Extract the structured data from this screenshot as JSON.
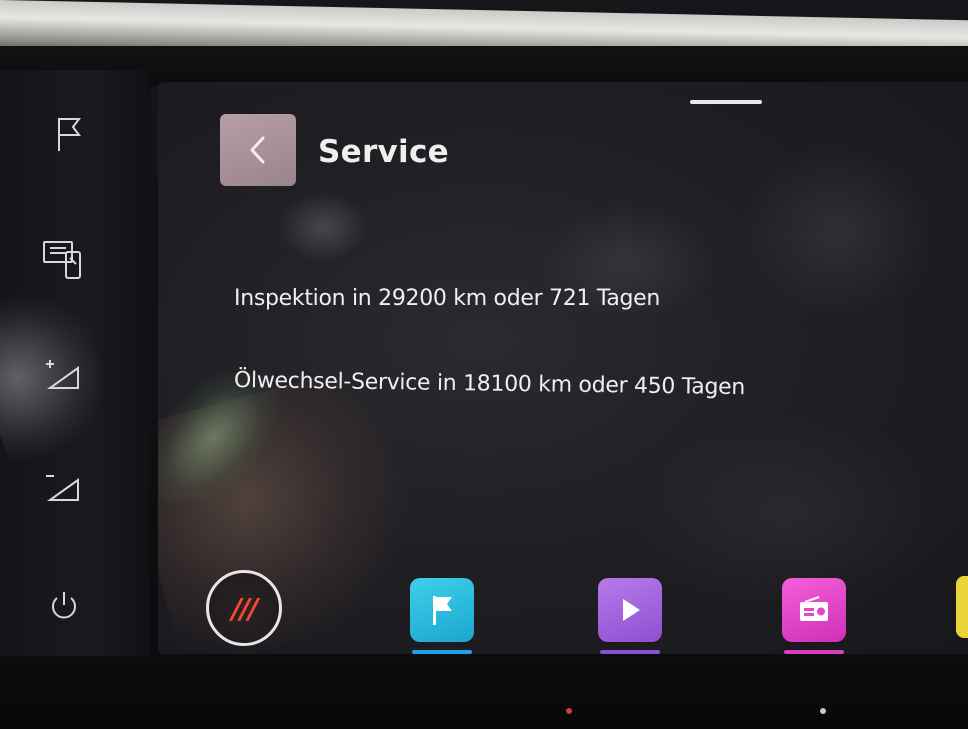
{
  "screen": {
    "title": "Service",
    "items": [
      {
        "text": "Inspektion in 29200 km oder 721 Tagen"
      },
      {
        "text": "Ölwechsel-Service in 18100 km oder 450 Tagen"
      }
    ],
    "back_icon": "chevron-left-icon"
  },
  "side_controls": [
    {
      "icon": "flag-icon"
    },
    {
      "icon": "phone-mirror-icon"
    },
    {
      "icon": "volume-up-icon"
    },
    {
      "icon": "volume-down-icon"
    },
    {
      "icon": "power-icon"
    }
  ],
  "dock": {
    "menu_glyph": "///",
    "menu_color": "#ee4a2e",
    "apps": [
      {
        "icon": "navigation-flag-icon",
        "color": "#2bbde0"
      },
      {
        "icon": "media-play-icon",
        "color": "#a565dd"
      },
      {
        "icon": "radio-icon",
        "color": "#e348c9"
      },
      {
        "icon": "phone-icon",
        "color": "#e9d43a"
      }
    ]
  }
}
